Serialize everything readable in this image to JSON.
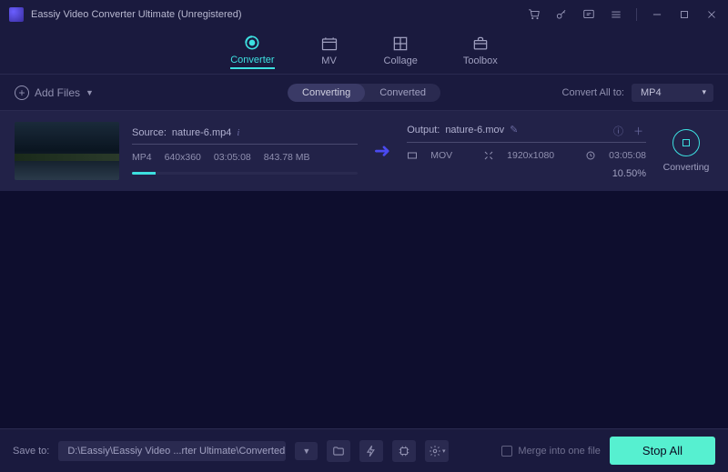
{
  "titlebar": {
    "title": "Eassiy Video Converter Ultimate (Unregistered)"
  },
  "nav": {
    "tabs": [
      {
        "label": "Converter",
        "active": true
      },
      {
        "label": "MV",
        "active": false
      },
      {
        "label": "Collage",
        "active": false
      },
      {
        "label": "Toolbox",
        "active": false
      }
    ]
  },
  "toolbar": {
    "add_files": "Add Files",
    "view_tabs": {
      "converting": "Converting",
      "converted": "Converted"
    },
    "convert_all_label": "Convert All to:",
    "convert_all_format": "MP4"
  },
  "file": {
    "source_label": "Source:",
    "source_name": "nature-6.mp4",
    "source_format": "MP4",
    "source_resolution": "640x360",
    "source_duration": "03:05:08",
    "source_size": "843.78 MB",
    "output_label": "Output:",
    "output_name": "nature-6.mov",
    "output_format": "MOV",
    "output_resolution": "1920x1080",
    "output_duration": "03:05:08",
    "progress_pct": "10.50%",
    "action_label": "Converting"
  },
  "bottom": {
    "save_label": "Save to:",
    "save_path": "D:\\Eassiy\\Eassiy Video ...rter Ultimate\\Converted",
    "merge_label": "Merge into one file",
    "stop_all": "Stop All"
  }
}
